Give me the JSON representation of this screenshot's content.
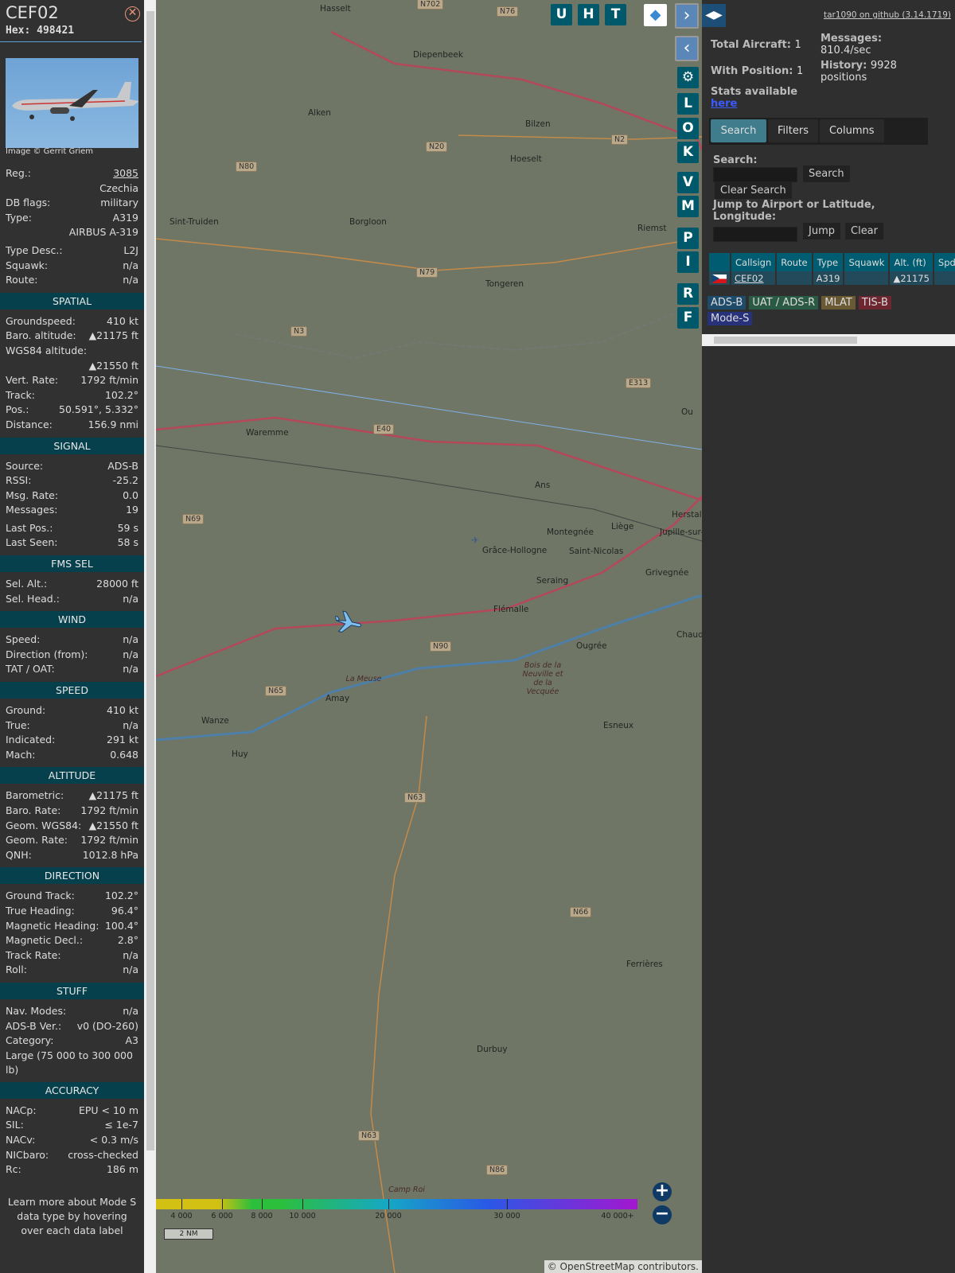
{
  "aircraft": {
    "callsign": "CEF02",
    "hex": "Hex: 498421",
    "photo_credit": "Image © Gerrit Griem"
  },
  "details": [
    {
      "l": "Reg.:",
      "v": "3085",
      "link": true
    },
    {
      "l": "",
      "v": "Czechia"
    },
    {
      "l": "DB flags:",
      "v": "military"
    },
    {
      "l": "Type:",
      "v": "A319"
    },
    {
      "l": "",
      "v": "AIRBUS A-319"
    },
    {
      "l": "Type Desc.:",
      "v": "L2J",
      "gap": true
    },
    {
      "l": "Squawk:",
      "v": "n/a"
    },
    {
      "l": "Route:",
      "v": "n/a"
    }
  ],
  "sections": [
    {
      "title": "SPATIAL",
      "rows": [
        {
          "l": "Groundspeed:",
          "v": "410 kt"
        },
        {
          "l": "Baro. altitude:",
          "v": "▲21175 ft"
        },
        {
          "l": "WGS84 altitude:",
          "v": ""
        },
        {
          "l": "",
          "v": "▲21550 ft"
        },
        {
          "l": "Vert. Rate:",
          "v": "1792 ft/min"
        },
        {
          "l": "Track:",
          "v": "102.2°"
        },
        {
          "l": "Pos.:",
          "v": "50.591°, 5.332°"
        },
        {
          "l": "Distance:",
          "v": "156.9 nmi"
        }
      ]
    },
    {
      "title": "SIGNAL",
      "rows": [
        {
          "l": "Source:",
          "v": "ADS-B"
        },
        {
          "l": "RSSI:",
          "v": "-25.2"
        },
        {
          "l": "Msg. Rate:",
          "v": "0.0"
        },
        {
          "l": "Messages:",
          "v": "19"
        },
        {
          "l": "Last Pos.:",
          "v": "59 s",
          "gap": true
        },
        {
          "l": "Last Seen:",
          "v": "58 s"
        }
      ]
    },
    {
      "title": "FMS SEL",
      "rows": [
        {
          "l": "Sel. Alt.:",
          "v": "28000 ft"
        },
        {
          "l": "Sel. Head.:",
          "v": "n/a"
        }
      ]
    },
    {
      "title": "WIND",
      "rows": [
        {
          "l": "Speed:",
          "v": "n/a"
        },
        {
          "l": "Direction (from):",
          "v": "n/a"
        },
        {
          "l": "TAT / OAT:",
          "v": "n/a"
        }
      ]
    },
    {
      "title": "SPEED",
      "rows": [
        {
          "l": "Ground:",
          "v": "410 kt"
        },
        {
          "l": "True:",
          "v": "n/a"
        },
        {
          "l": "Indicated:",
          "v": "291 kt"
        },
        {
          "l": "Mach:",
          "v": "0.648"
        }
      ]
    },
    {
      "title": "ALTITUDE",
      "rows": [
        {
          "l": "Barometric:",
          "v": "▲21175 ft"
        },
        {
          "l": "Baro. Rate:",
          "v": "1792 ft/min"
        },
        {
          "l": "Geom. WGS84:",
          "v": "▲21550 ft"
        },
        {
          "l": "Geom. Rate:",
          "v": "1792 ft/min"
        },
        {
          "l": "QNH:",
          "v": "1012.8 hPa"
        }
      ]
    },
    {
      "title": "DIRECTION",
      "rows": [
        {
          "l": "Ground Track:",
          "v": "102.2°"
        },
        {
          "l": "True Heading:",
          "v": "96.4°"
        },
        {
          "l": "Magnetic Heading:",
          "v": "100.4°"
        },
        {
          "l": "Magnetic Decl.:",
          "v": "2.8°"
        },
        {
          "l": "Track Rate:",
          "v": "n/a"
        },
        {
          "l": "Roll:",
          "v": "n/a"
        }
      ]
    },
    {
      "title": "STUFF",
      "rows": [
        {
          "l": "Nav. Modes:",
          "v": "n/a"
        },
        {
          "l": "ADS-B Ver.:",
          "v": "v0 (DO-260)"
        },
        {
          "l": "Category:",
          "v": "A3"
        },
        {
          "l": "Large (75 000 to 300 000 lb)",
          "v": "",
          "wrap": true
        }
      ]
    },
    {
      "title": "ACCURACY",
      "rows": [
        {
          "l": "NACp:",
          "v": "EPU < 10 m"
        },
        {
          "l": "SIL:",
          "v": "≤ 1e-7"
        },
        {
          "l": "NACv:",
          "v": "< 0.3 m/s"
        },
        {
          "l": "NICbaro:",
          "v": "cross-checked"
        },
        {
          "l": "Rc:",
          "v": "186 m"
        }
      ]
    }
  ],
  "footer_note": "Learn more about Mode S data type by hovering over each data label",
  "map": {
    "top_buttons": [
      "U",
      "H",
      "T"
    ],
    "side_buttons": [
      "L",
      "O",
      "K",
      "V",
      "M",
      "P",
      "I",
      "R",
      "F"
    ],
    "places": [
      [
        "Hasselt",
        422,
        12
      ],
      [
        "Diepenbeek",
        539,
        70
      ],
      [
        "Alken",
        407,
        143
      ],
      [
        "Bilzen",
        680,
        157
      ],
      [
        "Hoeselt",
        661,
        201
      ],
      [
        "Sint-Truiden",
        233,
        280
      ],
      [
        "Borgloon",
        459,
        280
      ],
      [
        "Riemst",
        821,
        288
      ],
      [
        "Tongeren",
        630,
        358
      ],
      [
        "Waremme",
        329,
        545
      ],
      [
        "Ans",
        692,
        611
      ],
      [
        "Herstal",
        864,
        648
      ],
      [
        "Montegnée",
        707,
        670
      ],
      [
        "Liège",
        788,
        663
      ],
      [
        "Jupille-sur-M",
        849,
        670
      ],
      [
        "Grâce-Hollogne",
        626,
        693
      ],
      [
        "Saint-Nicolas",
        735,
        694
      ],
      [
        "Seraing",
        694,
        731
      ],
      [
        "Grivegnée",
        831,
        721
      ],
      [
        "Flémalle",
        640,
        767
      ],
      [
        "Ougrée",
        744,
        813
      ],
      [
        "Chaud",
        870,
        799
      ],
      [
        "Ou",
        876,
        519
      ],
      [
        "Amay",
        429,
        879
      ],
      [
        "Wanze",
        273,
        907
      ],
      [
        "Esneux",
        778,
        913
      ],
      [
        "Huy",
        311,
        949
      ],
      [
        "Ferrières",
        807,
        1213
      ],
      [
        "Durbuy",
        619,
        1320
      ]
    ],
    "roads": [
      [
        "N702",
        536,
        6
      ],
      [
        "N76",
        636,
        15
      ],
      [
        "N20",
        547,
        185
      ],
      [
        "N2",
        780,
        176
      ],
      [
        "N80",
        308,
        210
      ],
      [
        "N79",
        535,
        343
      ],
      [
        "N3",
        377,
        417
      ],
      [
        "E313",
        798,
        482
      ],
      [
        "E40",
        481,
        540
      ],
      [
        "N69",
        241,
        653
      ],
      [
        "N90",
        552,
        813
      ],
      [
        "N65",
        345,
        869
      ],
      [
        "N63",
        520,
        1003
      ],
      [
        "N66",
        728,
        1147
      ],
      [
        "N63",
        462,
        1428
      ],
      [
        "N86",
        623,
        1471
      ]
    ],
    "italic": [
      [
        "La Meuse",
        457,
        855
      ],
      [
        "Bois de la Neuville et de la Vecquée",
        682,
        838
      ],
      [
        "Camp Roi",
        511,
        1497
      ]
    ],
    "altitude_ticks": [
      "4 000",
      "6 000",
      "8 000",
      "10 000",
      "20 000",
      "30 000",
      "40 000+"
    ],
    "scale": "2 NM",
    "attribution": "© OpenStreetMap contributors."
  },
  "panel": {
    "github": "tar1090 on github (3.14.1719)",
    "total_label": "Total Aircraft:",
    "total": "1",
    "pos_label": "With Position:",
    "pos": "1",
    "msg_label": "Messages:",
    "msg": "810.4/sec",
    "hist_label": "History:",
    "hist": "9928 positions",
    "stats_label": "Stats available",
    "stats_link": "here",
    "tabs": [
      "Search",
      "Filters",
      "Columns"
    ],
    "search_label": "Search:",
    "search_btn": "Search",
    "clear_search": "Clear Search",
    "jump_label": "Jump to Airport or Latitude, Longitude:",
    "jump_btn": "Jump",
    "clear_btn": "Clear",
    "columns": [
      "",
      "Callsign",
      "Route",
      "Type",
      "Squawk",
      "Alt. (ft)",
      "Spd"
    ],
    "rows": [
      {
        "callsign": "CEF02",
        "route": "",
        "type": "A319",
        "squawk": "",
        "alt": "▲21175",
        "spd": ""
      }
    ],
    "legend": [
      {
        "t": "ADS-B",
        "c": "#1f4b6b"
      },
      {
        "t": "UAT / ADS-R",
        "c": "#2b5a44"
      },
      {
        "t": "MLAT",
        "c": "#6a5a34"
      },
      {
        "t": "TIS-B",
        "c": "#6e2630"
      },
      {
        "t": "Mode-S",
        "c": "#27327a"
      }
    ]
  }
}
